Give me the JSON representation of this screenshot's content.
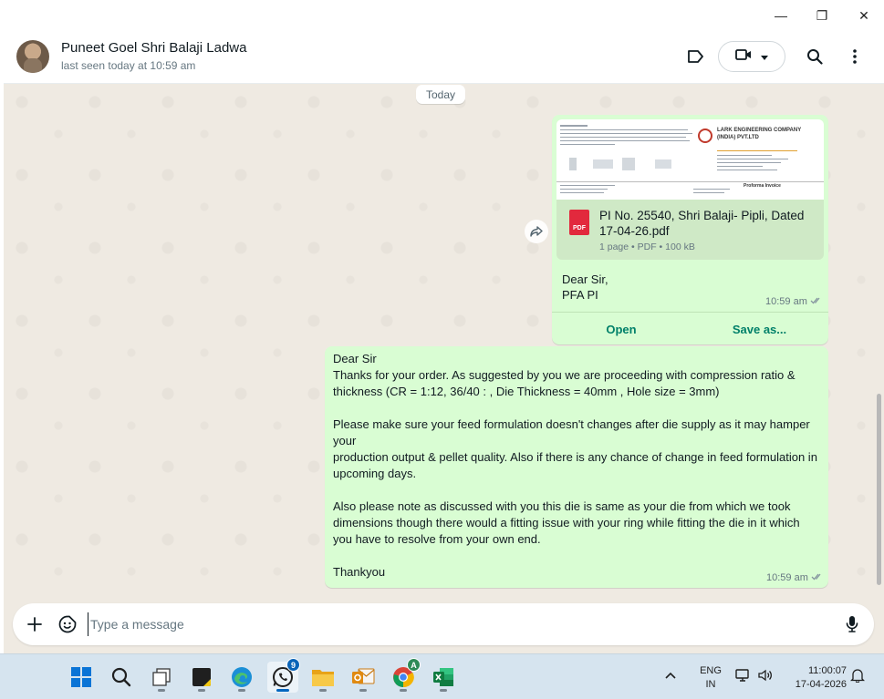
{
  "window": {
    "minimize_glyph": "—",
    "maximize_glyph": "❐",
    "close_glyph": "✕"
  },
  "header": {
    "contact_name": "Puneet Goel Shri Balaji Ladwa",
    "status": "last seen today at 10:59 am"
  },
  "chat": {
    "date_chip": "Today",
    "document_message": {
      "preview": {
        "company_name": "LARK ENGINEERING COMPANY (INDIA) PVT.LTD",
        "doc_label": "Proforma Invoice"
      },
      "file_name": "PI No. 25540, Shri Balaji- Pipli, Dated 17-04-26.pdf",
      "file_type_badge": "PDF",
      "meta": "1 page • PDF • 100 kB",
      "caption": "Dear Sir,\nPFA PI",
      "time": "10:59 am",
      "open_label": "Open",
      "save_label": "Save as..."
    },
    "text_message": {
      "body": "Dear Sir\nThanks for your order. As suggested by you we are proceeding with compression ratio & thickness (CR = 1:12, 36/40 :  , Die Thickness = 40mm , Hole size = 3mm)\n\nPlease make sure your feed formulation doesn't changes after die supply as it may hamper your\nproduction output & pellet quality. Also if there is any chance of change in feed formulation in upcoming days.\n\nAlso please note as discussed with you this die is same as your die from which we took dimensions though there would a fitting issue with your ring while fitting the die in it which you have to resolve from your own end.\n\nThankyou",
      "time": "10:59 am"
    }
  },
  "composer": {
    "placeholder": "Type a message"
  },
  "taskbar": {
    "icons": [
      "windows-start-icon",
      "search-icon",
      "task-view-icon",
      "sticky-notes-icon",
      "edge-icon",
      "whatsapp-icon",
      "file-explorer-icon",
      "outlook-icon",
      "chrome-icon",
      "excel-icon"
    ],
    "whatsapp_badge": "9",
    "chrome_badge": "A",
    "lang_line1": "ENG",
    "lang_line2": "IN",
    "time": "11:00:07",
    "date": "17-04-2026"
  },
  "colors": {
    "outgoing_bubble": "#d9fdd3",
    "chat_background": "#efeae2",
    "accent_green": "#008069",
    "taskbar": "#d6e4ef"
  }
}
